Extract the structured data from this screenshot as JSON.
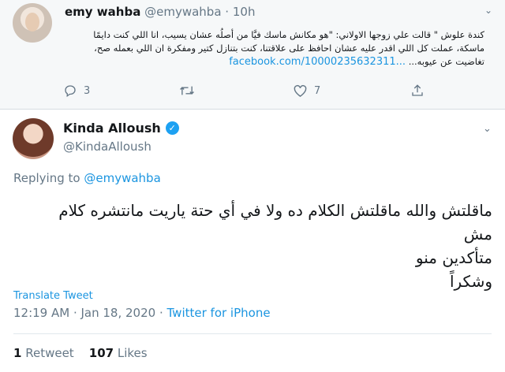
{
  "parent_tweet": {
    "name": "emy wahba",
    "handle": "@emywahba",
    "separator": "·",
    "time": "10h",
    "text": "كندة علوش \" قالت  علي زوجها الاولاني: \"هو مكانش ماسك فيَّا من أصلُه عشان يسيب، انا اللي كنت دايمًا ماسكة، عملت كل اللي اقدر عليه عشان احافظ على علاقتنا، كنت بتنازل كتير ومفكرة ان اللي بعمله صح، تغاضيت عن عيوبه...",
    "link": "facebook.com/10000235632311...",
    "reply_count": "3",
    "retweet_count": "",
    "like_count": "7"
  },
  "main_tweet": {
    "name": "Kinda Alloush",
    "handle": "@KindaAlloush",
    "verified_mark": "✓",
    "replying_prefix": "Replying to",
    "replying_to": "@emywahba",
    "text_line1": "ماقلتش والله ماقلتش الكلام ده ولا في أي حتة ياريت مانتشره كلام مش",
    "text_line2": "متأكدين منو",
    "text_line3": "وشكراً",
    "translate_label": "Translate Tweet",
    "timestamp": "12:19 AM · Jan 18, 2020 · ",
    "source": "Twitter for iPhone",
    "retweets_count": "1",
    "retweets_label": "Retweet",
    "likes_count": "107",
    "likes_label": "Likes"
  },
  "icons": {
    "reply": "reply-icon",
    "retweet": "retweet-icon",
    "like": "heart-icon",
    "share": "share-icon",
    "verified": "verified-badge-icon",
    "more": "chevron-down-icon"
  },
  "colors": {
    "link": "#1b95e0",
    "secondary_text": "#657786",
    "verified": "#1da1f2"
  }
}
